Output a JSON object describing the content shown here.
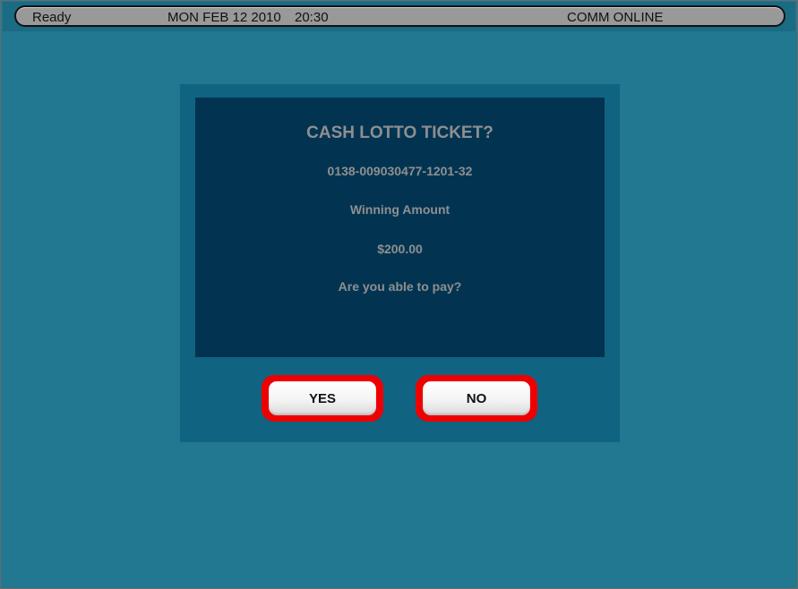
{
  "status_bar": {
    "state": "Ready",
    "date": "MON FEB 12 2010",
    "time": "20:30",
    "comm": "COMM ONLINE"
  },
  "dialog": {
    "title": "CASH LOTTO TICKET?",
    "ticket_number": "0138-009030477-1201-32",
    "winning_label": "Winning Amount",
    "winning_amount": "$200.00",
    "question": "Are you able to pay?",
    "yes_label": "YES",
    "no_label": "NO"
  },
  "colors": {
    "background": "#227791",
    "dialog_frame": "#106381",
    "dialog_panel": "#023452",
    "dialog_text": "#8f8f8f",
    "button_highlight": "#ee0000",
    "status_bar": "#999999"
  }
}
